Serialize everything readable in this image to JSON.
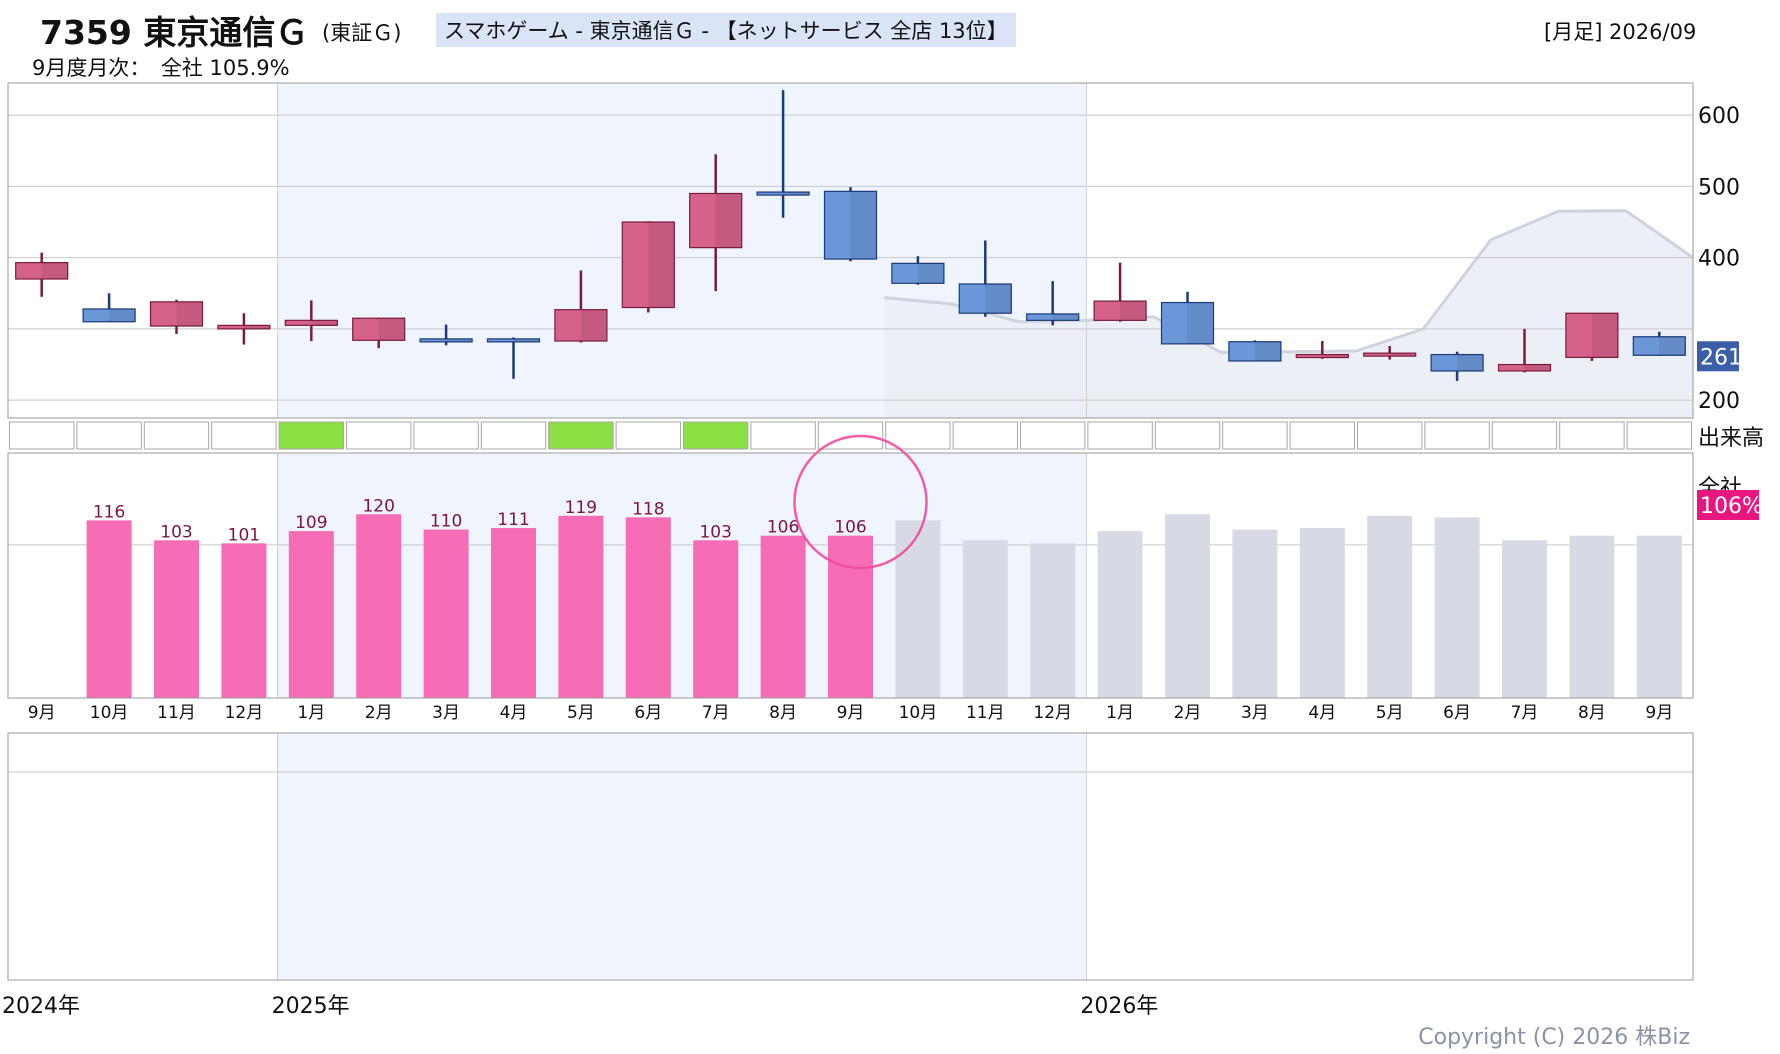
{
  "header": {
    "ticker": "7359 東京通信Ｇ",
    "exchange": "(東証Ｇ)",
    "headline": "スマホゲーム - 東京通信Ｇ - 【ネットサービス 全店 13位】",
    "timeframe": "[月足] 2026/09",
    "monthly_label": "9月度月次：　全社 105.9%"
  },
  "chart_data": [
    {
      "type": "candlestick",
      "name": "price",
      "yticks": [
        200,
        400,
        500,
        600
      ],
      "ylim": [
        175,
        645
      ],
      "last_price_badge": "261",
      "candles": [
        {
          "o": 370,
          "h": 407,
          "l": 345,
          "c": 393
        },
        {
          "o": 328,
          "h": 350,
          "l": 311,
          "c": 310
        },
        {
          "o": 304,
          "h": 341,
          "l": 293,
          "c": 338
        },
        {
          "o": 300,
          "h": 322,
          "l": 278,
          "c": 305
        },
        {
          "o": 305,
          "h": 340,
          "l": 283,
          "c": 312
        },
        {
          "o": 284,
          "h": 316,
          "l": 273,
          "c": 315
        },
        {
          "o": 286,
          "h": 306,
          "l": 277,
          "c": 285
        },
        {
          "o": 286,
          "h": 288,
          "l": 230,
          "c": 284
        },
        {
          "o": 283,
          "h": 382,
          "l": 281,
          "c": 327
        },
        {
          "o": 330,
          "h": 451,
          "l": 323,
          "c": 450
        },
        {
          "o": 414,
          "h": 545,
          "l": 353,
          "c": 490
        },
        {
          "o": 492,
          "h": 635,
          "l": 456,
          "c": 489
        },
        {
          "o": 493,
          "h": 499,
          "l": 395,
          "c": 398
        },
        {
          "o": 392,
          "h": 402,
          "l": 362,
          "c": 364
        },
        {
          "o": 363,
          "h": 424,
          "l": 317,
          "c": 322
        },
        {
          "o": 321,
          "h": 367,
          "l": 305,
          "c": 312
        },
        {
          "o": 312,
          "h": 393,
          "l": 310,
          "c": 339
        },
        {
          "o": 337,
          "h": 352,
          "l": 279,
          "c": 279
        },
        {
          "o": 282,
          "h": 284,
          "l": 257,
          "c": 255
        },
        {
          "o": 264,
          "h": 283,
          "l": 258,
          "c": 264
        },
        {
          "o": 263,
          "h": 276,
          "l": 257,
          "c": 266
        },
        {
          "o": 264,
          "h": 268,
          "l": 227,
          "c": 241
        },
        {
          "o": 241,
          "h": 300,
          "l": 239,
          "c": 250
        },
        {
          "o": 260,
          "h": 322,
          "l": 255,
          "c": 322
        },
        {
          "o": 289,
          "h": 296,
          "l": 262,
          "c": 263
        }
      ],
      "shade_line": [
        {
          "i": 13,
          "v": 344
        },
        {
          "i": 14,
          "v": 335
        },
        {
          "i": 15,
          "v": 310
        },
        {
          "i": 16,
          "v": 312
        },
        {
          "i": 17,
          "v": 317
        },
        {
          "i": 18,
          "v": 267
        },
        {
          "i": 19,
          "v": 268
        },
        {
          "i": 20,
          "v": 269
        },
        {
          "i": 21,
          "v": 300
        },
        {
          "i": 22,
          "v": 425
        },
        {
          "i": 23,
          "v": 465
        },
        {
          "i": 24,
          "v": 466
        },
        {
          "i": 25,
          "v": 400
        }
      ]
    },
    {
      "type": "volume_cells",
      "name": "出来高",
      "label": "出来高",
      "highlighted": [
        4,
        8,
        10
      ]
    },
    {
      "type": "bar",
      "name": "全社",
      "label": "全社",
      "badge": "106%",
      "ylim": [
        0,
        160
      ],
      "values": [
        116,
        103,
        101,
        109,
        120,
        110,
        111,
        119,
        118,
        103,
        106,
        106
      ],
      "labels": [
        "116",
        "103",
        "101",
        "109",
        "120",
        "110",
        "111",
        "119",
        "118",
        "103",
        "106",
        "106"
      ],
      "ghost_values": [
        116,
        103,
        101,
        109,
        120,
        110,
        111,
        119,
        118,
        103,
        106,
        106
      ]
    }
  ],
  "axis": {
    "months": [
      "9月",
      "10月",
      "11月",
      "12月",
      "1月",
      "2月",
      "3月",
      "4月",
      "5月",
      "6月",
      "7月",
      "8月",
      "9月",
      "10月",
      "11月",
      "12月",
      "1月",
      "2月",
      "3月",
      "4月",
      "5月",
      "6月",
      "7月",
      "8月",
      "9月"
    ],
    "years": [
      {
        "label": "2024年",
        "start": 0
      },
      {
        "label": "2025年",
        "start": 4
      },
      {
        "label": "2026年",
        "start": 16
      }
    ]
  },
  "colors": {
    "up_body": "#d6628c",
    "up_wick": "#7a1d3c",
    "down_body": "#6b97d8",
    "down_wick": "#1c3a78",
    "bar": "#f66db5",
    "ghost_bar": "#d7d9e5",
    "year_band": "#eff4fd",
    "volume_highlight": "#8ce043",
    "badge_price": "#3a5ea8",
    "badge_pct": "#e8177f",
    "circle": "#f24a9c",
    "copyright": "#8a93a6"
  },
  "copyright": "Copyright (C) 2026 株Biz"
}
